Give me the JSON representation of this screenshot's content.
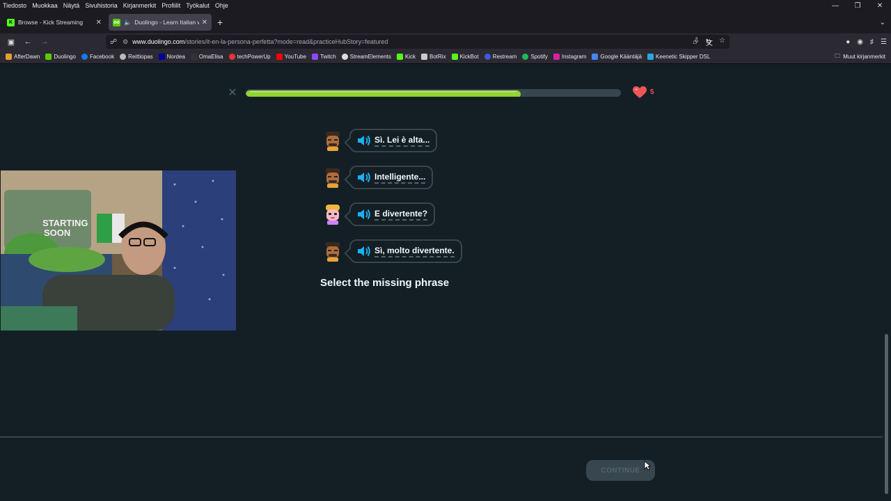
{
  "menubar": {
    "items": [
      "Tiedosto",
      "Muokkaa",
      "Näytä",
      "Sivuhistoria",
      "Kirjanmerkit",
      "Profiilit",
      "Työkalut",
      "Ohje"
    ]
  },
  "tabs": [
    {
      "title": "Browse - Kick Streaming",
      "icon": "kick-icon",
      "active": false
    },
    {
      "title": "Duolingo - Learn Italian wit",
      "icon": "duolingo-icon",
      "active": true
    }
  ],
  "url": {
    "domain": "www.duolingo.com",
    "path": "/stories/it-en-la-persona-perfetta?mode=read&practiceHubStory=featured"
  },
  "bookmarks": {
    "items": [
      "AfterDawn",
      "Duolingo",
      "Facebook",
      "Reittiopas",
      "Nordea",
      "OmaElisa",
      "techPowerUp",
      "YouTube",
      "Twitch",
      "StreamElements",
      "Kick",
      "BotRix",
      "KickBot",
      "Restream",
      "Spotify",
      "Instagram",
      "Google Kääntäjä",
      "Keenetic Skipper DSL"
    ],
    "other": "Muut kirjanmerkit"
  },
  "lesson": {
    "progress": 0.733,
    "hearts": "5",
    "lines": [
      {
        "speaker": "man",
        "text": "Sì. Lei è alta..."
      },
      {
        "speaker": "man",
        "text": "Intelligente..."
      },
      {
        "speaker": "woman",
        "text": "E divertente?"
      },
      {
        "speaker": "man",
        "text": "Sì, molto divertente."
      }
    ],
    "prompt": "Select the missing phrase",
    "continue_label": "CONTINUE"
  },
  "colors": {
    "progress": "#93d333",
    "heart": "#ee5555",
    "background": "#131f24",
    "speaker": "#1cb0f6"
  }
}
